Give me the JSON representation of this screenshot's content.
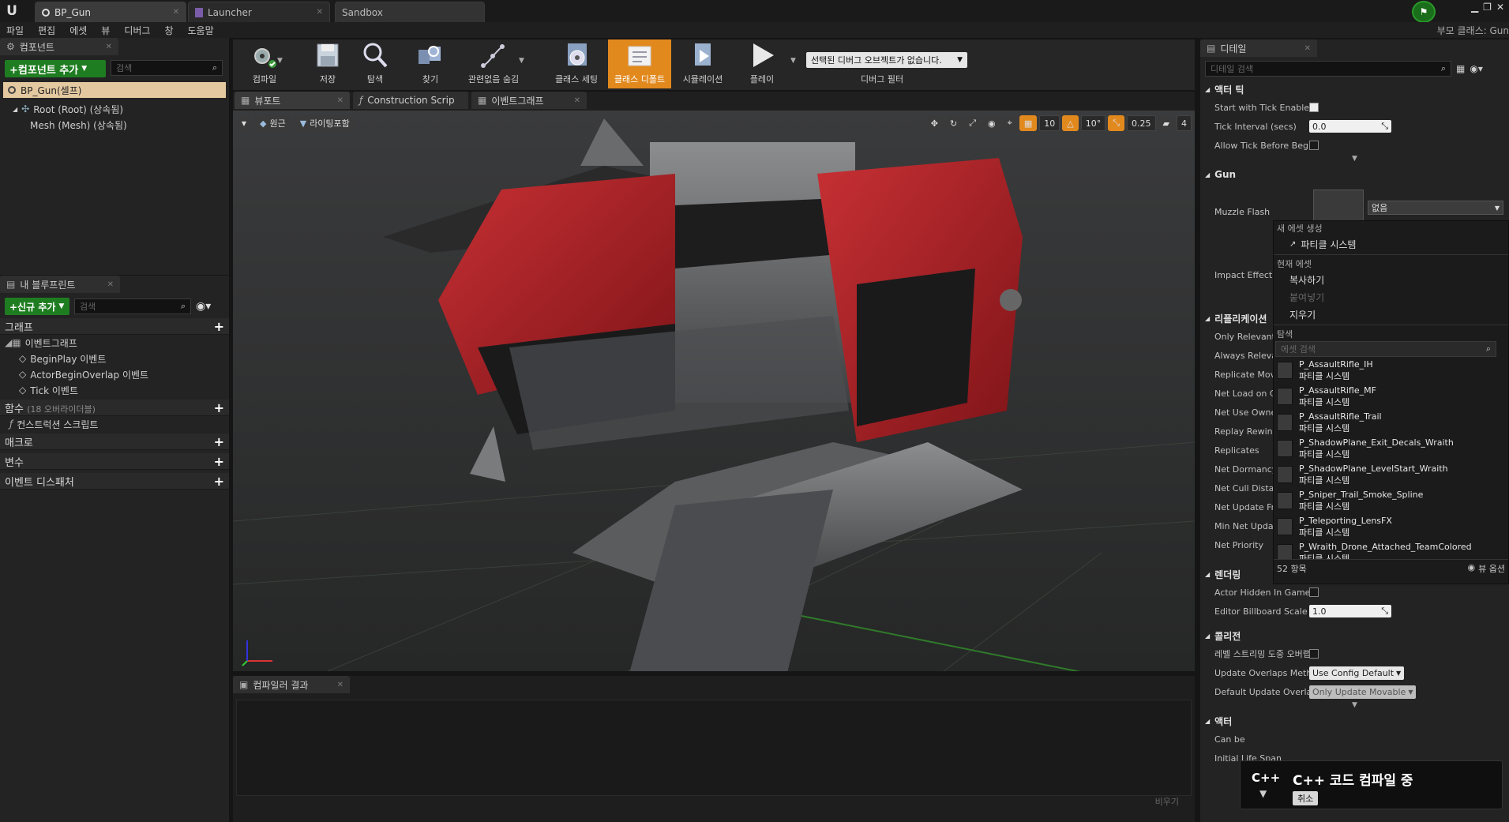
{
  "window": {
    "tabs": [
      {
        "label": "BP_Gun",
        "active": true
      },
      {
        "label": "Launcher",
        "active": false
      },
      {
        "label": "Sandbox",
        "active": false
      }
    ],
    "parent_class": "부모 클래스: Gun"
  },
  "menu": [
    "파일",
    "편집",
    "에셋",
    "뷰",
    "디버그",
    "창",
    "도움말"
  ],
  "components": {
    "tab_label": "컴포넌트",
    "add_button": "+컴포넌트 추가",
    "search_placeholder": "검색",
    "self_item": "BP_Gun(셀프)",
    "tree": [
      {
        "label": "Root (Root) (상속됨)"
      },
      {
        "label": "Mesh (Mesh) (상속됨)"
      }
    ]
  },
  "my_blueprint": {
    "tab_label": "내 블루프린트",
    "add_button": "+신규 추가",
    "search_placeholder": "검색",
    "graph_label": "그래프",
    "event_graph": "이벤트그래프",
    "events": [
      "BeginPlay 이벤트",
      "ActorBeginOverlap 이벤트",
      "Tick 이벤트"
    ],
    "functions_label": "함수",
    "functions_count": "(18 오버라이더블)",
    "construction_script": "컨스트럭션 스크립트",
    "macros_label": "매크로",
    "variables_label": "변수",
    "dispatchers_label": "이벤트 디스패처"
  },
  "toolbar": {
    "items": [
      {
        "label": "컴파일",
        "icon": "compile-icon"
      },
      {
        "label": "저장",
        "icon": "save-icon"
      },
      {
        "label": "탐색",
        "icon": "browse-icon"
      },
      {
        "label": "찾기",
        "icon": "find-icon"
      },
      {
        "label": "관련없음 숨김",
        "icon": "hide-unrelated-icon"
      },
      {
        "label": "클래스 세팅",
        "icon": "class-settings-icon"
      },
      {
        "label": "클래스 디폴트",
        "icon": "class-defaults-icon"
      },
      {
        "label": "시뮬레이션",
        "icon": "simulation-icon"
      },
      {
        "label": "플레이",
        "icon": "play-icon"
      }
    ],
    "active_index": 6,
    "debug_object": "선택된 디버그 오브젝트가 없습니다.",
    "debug_filter": "디버그 필터"
  },
  "editor_tabs": [
    {
      "label": "뷰포트",
      "active": true
    },
    {
      "label": "Construction Scrip",
      "active": false
    },
    {
      "label": "이벤트그래프",
      "active": false
    }
  ],
  "viewport": {
    "perspective_label": "원근",
    "lighting_label": "라이팅포함",
    "grid_snap": "10",
    "rotation_snap": "10°",
    "scale_snap": "0.25",
    "camera_speed": "4",
    "accent": "#e2891e"
  },
  "compiler_results": {
    "tab_label": "컴파일러 결과",
    "clear_label": "비우기"
  },
  "details": {
    "tab_label": "디테일",
    "search_placeholder": "디테일 검색",
    "sections": {
      "actor_tick": "액터 틱",
      "gun": "Gun",
      "replication": "리플리케이션",
      "rendering": "렌더링",
      "collision": "콜리전",
      "actor": "액터"
    },
    "tick_props": {
      "start_with_tick": "Start with Tick Enabled",
      "tick_interval": "Tick Interval (secs)",
      "tick_interval_value": "0.0",
      "allow_tick_before_begin": "Allow Tick Before Begin"
    },
    "gun_props": {
      "muzzle_flash": "Muzzle Flash",
      "muzzle_value": "없음",
      "impact_effect": "Impact Effect"
    },
    "replication_props": [
      "Only Relevant",
      "Always Releva",
      "Replicate Mov",
      "Net Load on Cl",
      "Net Use Owne",
      "Replay Rewind",
      "Replicates",
      "Net Dormancy",
      "Net Cull Distar",
      "Net Update Fre",
      "Min Net Updat",
      "Net Priority"
    ],
    "rendering_props": {
      "actor_hidden": "Actor Hidden In Game",
      "billboard_scale": "Editor Billboard Scale",
      "billboard_value": "1.0"
    },
    "collision_props": {
      "level_streaming": "레벨 스트리밍 도중 오버랩",
      "update_overlaps": "Update Overlaps Metho",
      "update_overlaps_value": "Use Config Default",
      "default_update": "Default Update Overlap",
      "default_update_value": "Only Update Movable"
    },
    "actor_props": [
      "Can be",
      "Initial Life Span"
    ]
  },
  "asset_picker": {
    "create_label": "새 에셋 생성",
    "create_item": "파티클 시스템",
    "current_label": "현재 에셋",
    "copy": "복사하기",
    "paste": "붙여넣기",
    "clear": "지우기",
    "browse_label": "탐색",
    "search_placeholder": "에셋 검색",
    "assets": [
      {
        "name": "P_AssaultRifle_IH",
        "type": "파티클 시스템"
      },
      {
        "name": "P_AssaultRifle_MF",
        "type": "파티클 시스템"
      },
      {
        "name": "P_AssaultRifle_Trail",
        "type": "파티클 시스템"
      },
      {
        "name": "P_ShadowPlane_Exit_Decals_Wraith",
        "type": "파티클 시스템"
      },
      {
        "name": "P_ShadowPlane_LevelStart_Wraith",
        "type": "파티클 시스템"
      },
      {
        "name": "P_Sniper_Trail_Smoke_Spline",
        "type": "파티클 시스템"
      },
      {
        "name": "P_Teleporting_LensFX",
        "type": "파티클 시스템"
      },
      {
        "name": "P_Wraith_Drone_Attached_TeamColored",
        "type": "파티클 시스템"
      }
    ],
    "count": "52 항목",
    "view_options": "뷰 옵션"
  },
  "notification": {
    "title": "C++ 코드 컴파일 중",
    "cancel": "취소",
    "icon_text": "C++"
  }
}
